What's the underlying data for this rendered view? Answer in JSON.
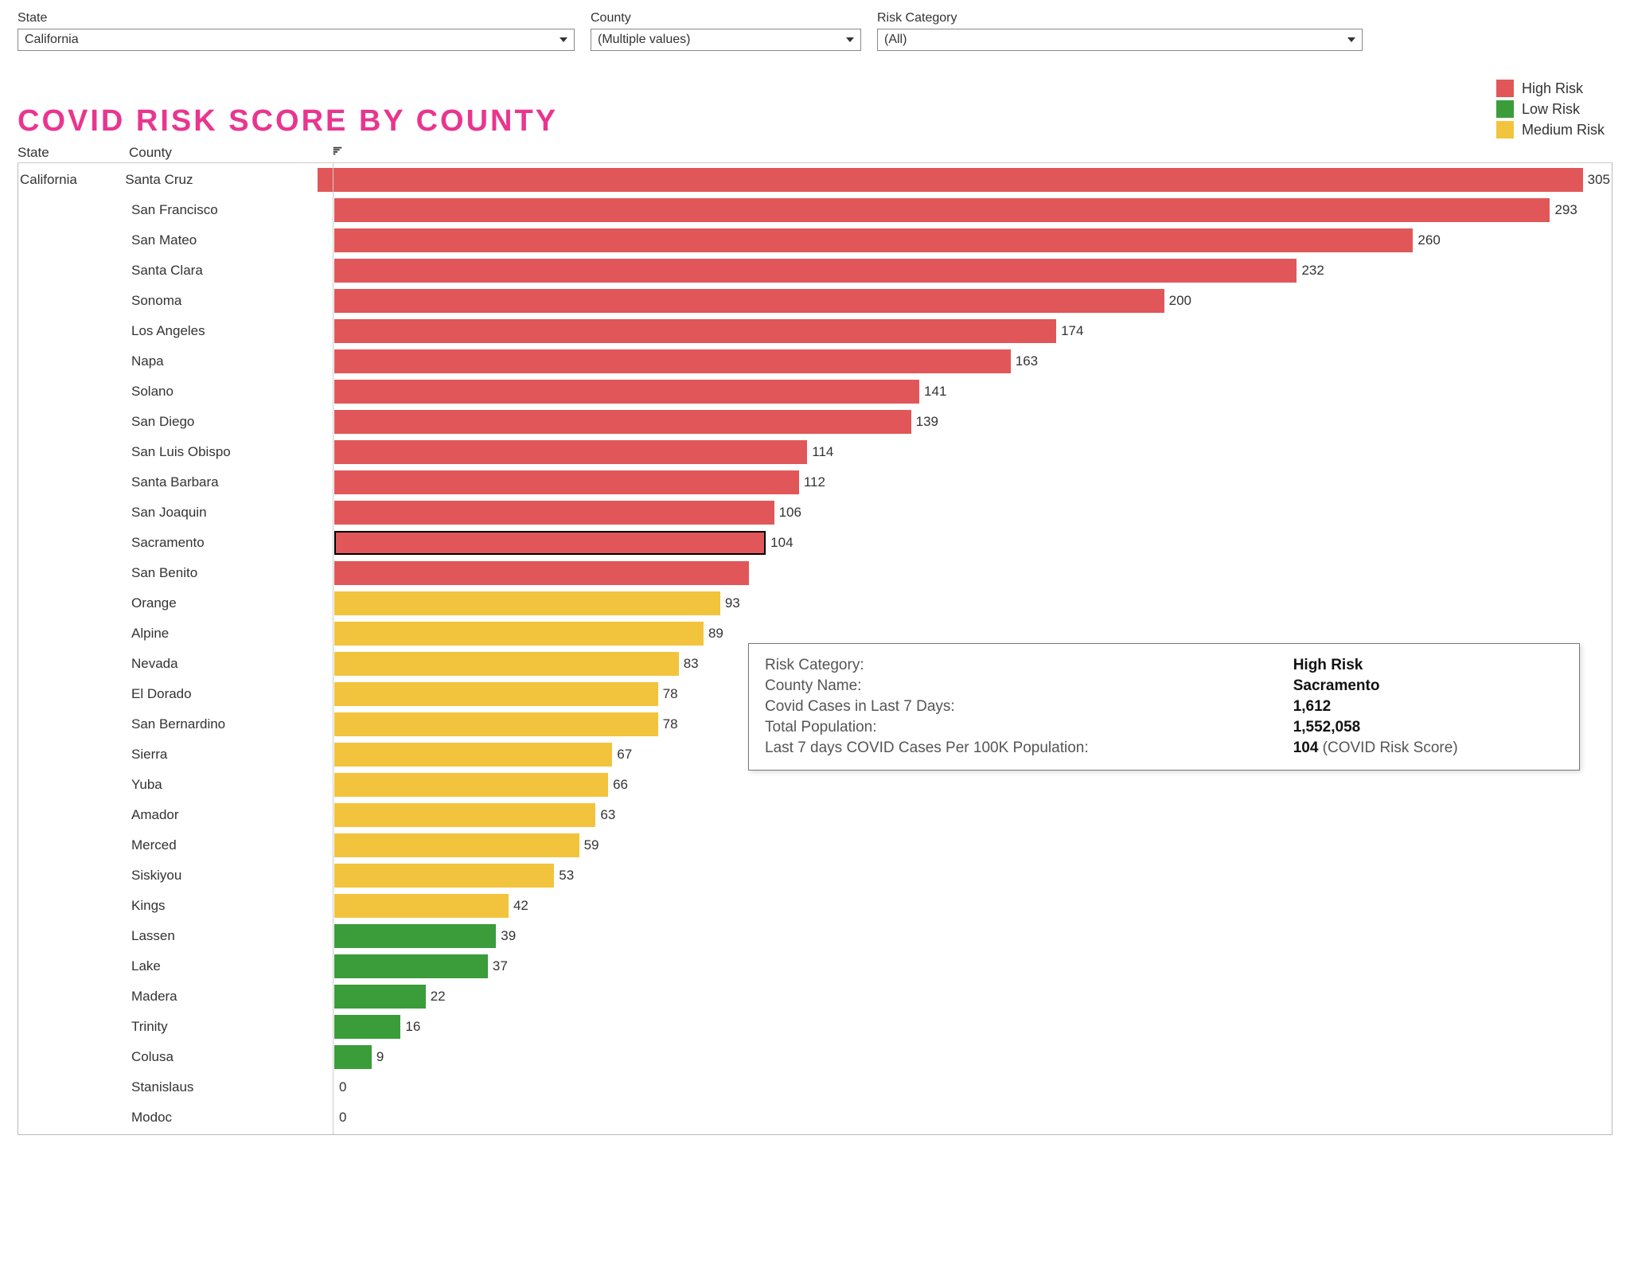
{
  "filters": {
    "state": {
      "label": "State",
      "value": "California"
    },
    "county": {
      "label": "County",
      "value": "(Multiple values)"
    },
    "risk_category": {
      "label": "Risk Category",
      "value": "(All)"
    }
  },
  "title": "COVID Risk Score By County",
  "legend": {
    "high": "High Risk",
    "low": "Low Risk",
    "medium": "Medium Risk"
  },
  "columns": {
    "state": "State",
    "county": "County"
  },
  "state_name": "California",
  "colors": {
    "high": "#e15759",
    "low": "#3a9d3a",
    "medium": "#f2c43d"
  },
  "chart_data": {
    "type": "bar",
    "title": "COVID Risk Score By County",
    "xlabel": "",
    "ylabel": "",
    "xlim": [
      0,
      305
    ],
    "categories": [
      "Santa Cruz",
      "San Francisco",
      "San Mateo",
      "Santa Clara",
      "Sonoma",
      "Los Angeles",
      "Napa",
      "Solano",
      "San Diego",
      "San Luis Obispo",
      "Santa Barbara",
      "San Joaquin",
      "Sacramento",
      "San Benito",
      "Orange",
      "Alpine",
      "Nevada",
      "El Dorado",
      "San Bernardino",
      "Sierra",
      "Yuba",
      "Amador",
      "Merced",
      "Siskiyou",
      "Kings",
      "Lassen",
      "Lake",
      "Madera",
      "Trinity",
      "Colusa",
      "Stanislaus",
      "Modoc"
    ],
    "values": [
      305,
      293,
      260,
      232,
      200,
      174,
      163,
      141,
      139,
      114,
      112,
      106,
      104,
      100,
      93,
      89,
      83,
      78,
      78,
      67,
      66,
      63,
      59,
      53,
      42,
      39,
      37,
      22,
      16,
      9,
      0,
      0
    ],
    "risk": [
      "high",
      "high",
      "high",
      "high",
      "high",
      "high",
      "high",
      "high",
      "high",
      "high",
      "high",
      "high",
      "high",
      "high",
      "medium",
      "medium",
      "medium",
      "medium",
      "medium",
      "medium",
      "medium",
      "medium",
      "medium",
      "medium",
      "medium",
      "low",
      "low",
      "low",
      "low",
      "low",
      "low",
      "low"
    ],
    "highlighted_index": 12,
    "hide_label_indices": [
      13
    ]
  },
  "tooltip": {
    "rows": [
      {
        "label": "Risk Category:",
        "value": "High Risk"
      },
      {
        "label": "County Name:",
        "value": "Sacramento"
      },
      {
        "label": "Covid Cases in Last 7 Days:",
        "value": "1,612"
      },
      {
        "label": "Total Population:",
        "value": "1,552,058"
      },
      {
        "label": "Last 7 days COVID Cases Per 100K Population:",
        "value": "104",
        "extra": " (COVID Risk Score)"
      }
    ]
  }
}
